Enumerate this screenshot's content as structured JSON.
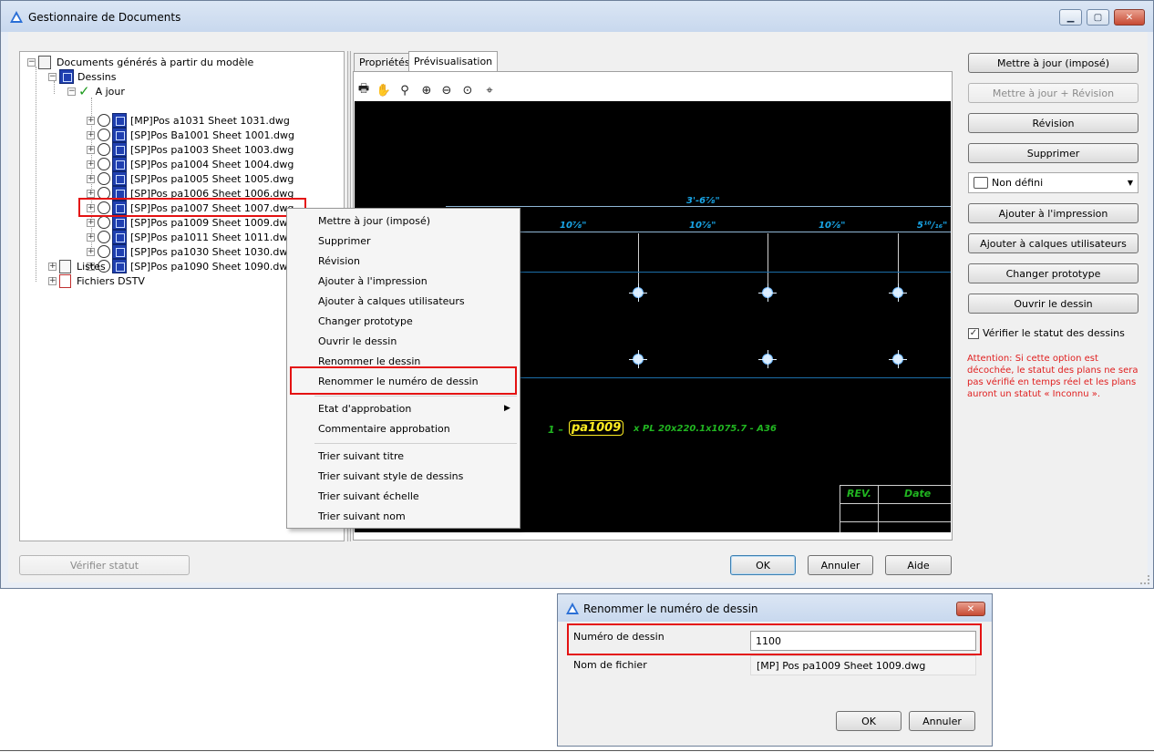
{
  "main_window": {
    "title": "Gestionnaire de Documents",
    "tree": {
      "root": "Documents générés à partir du modèle",
      "dessins": "Dessins",
      "a_jour": "A jour",
      "files": [
        "[MP]Pos a1031 Sheet 1031.dwg",
        "[SP]Pos Ba1001 Sheet 1001.dwg",
        "[SP]Pos pa1003 Sheet 1003.dwg",
        "[SP]Pos pa1004 Sheet 1004.dwg",
        "[SP]Pos pa1005 Sheet 1005.dwg",
        "[SP]Pos pa1006 Sheet 1006.dwg",
        "[SP]Pos pa1007 Sheet 1007.dwg",
        "[SP]Pos pa1009 Sheet 1009.dwg",
        "[SP]Pos pa1011 Sheet 1011.dwg",
        "[SP]Pos pa1030 Sheet 1030.dwg",
        "[SP]Pos pa1090 Sheet 1090.dwg"
      ],
      "listes": "Listes",
      "fichiers_dstv": "Fichiers DSTV"
    },
    "tabs": [
      "Propriétés",
      "Prévisualisation"
    ],
    "preview": {
      "dim_total": "3'-6⅞\"",
      "dims": [
        "10⅞\"",
        "10⅞\"",
        "10⅞\"",
        "5¹⁰/₁₆\""
      ],
      "part_prefix": "1 –",
      "part_mark": "pa1009",
      "part_desc": "x PL 20x220.1x1075.7 - A36",
      "rev_label": "REV.",
      "date_label": "Date"
    },
    "buttons": {
      "update_forced": "Mettre à jour (imposé)",
      "update_revision": "Mettre à jour + Révision",
      "revision": "Révision",
      "delete": "Supprimer",
      "add_print": "Ajouter à l'impression",
      "add_layers": "Ajouter à calques utilisateurs",
      "change_prototype": "Changer prototype",
      "open_drawing": "Ouvrir le dessin",
      "verify_status": "Vérifier statut",
      "ok": "OK",
      "cancel": "Annuler",
      "help": "Aide"
    },
    "combo_value": "Non défini",
    "check_status_label": "Vérifier le statut des dessins",
    "warning": "Attention: Si cette option est décochée, le statut des plans ne sera pas vérifié en temps réel et les plans auront un statut « Inconnu »."
  },
  "context_menu": {
    "items": [
      "Mettre à jour (imposé)",
      "Supprimer",
      "Révision",
      "Ajouter à l'impression",
      "Ajouter à calques utilisateurs",
      "Changer prototype",
      "Ouvrir le dessin",
      "Renommer le dessin",
      "Renommer le numéro de dessin",
      "Etat d'approbation",
      "Commentaire approbation",
      "Trier suivant titre",
      "Trier suivant style de dessins",
      "Trier suivant échelle",
      "Trier suivant nom"
    ]
  },
  "rename_dialog": {
    "title": "Renommer le numéro de dessin",
    "number_label": "Numéro de dessin",
    "number_value": "1100",
    "filename_label": "Nom de fichier",
    "filename_value": "[MP] Pos pa1009 Sheet 1009.dwg",
    "ok": "OK",
    "cancel": "Annuler"
  }
}
